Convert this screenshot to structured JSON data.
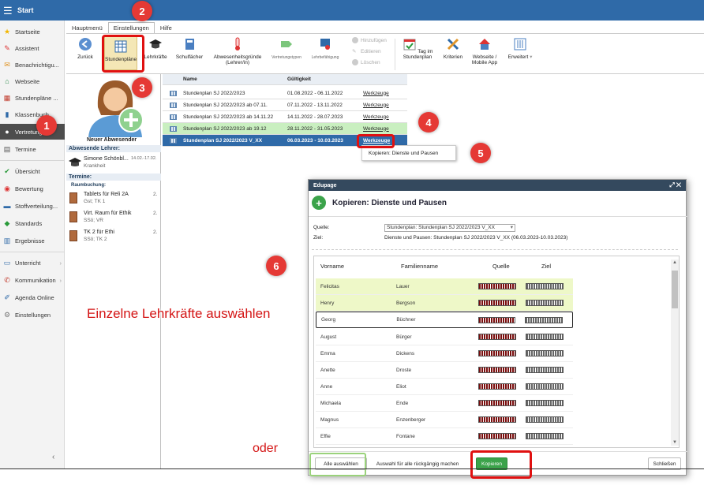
{
  "topbar": {
    "title": "Start"
  },
  "sidebar": {
    "items": [
      {
        "label": "Startseite",
        "icon": "star-icon"
      },
      {
        "label": "Assistent",
        "icon": "wand-icon"
      },
      {
        "label": "Benachrichtigu...",
        "icon": "envelope-icon"
      },
      {
        "label": "Webseite",
        "icon": "home-icon"
      },
      {
        "label": "Stundenpläne ...",
        "icon": "calendar-icon"
      },
      {
        "label": "Klassenbuch",
        "icon": "book-icon"
      },
      {
        "label": "Vertretung",
        "icon": "user-icon"
      },
      {
        "label": "Termine",
        "icon": "calendar-grid-icon"
      },
      {
        "label": "Übersicht",
        "icon": "check-circle-icon"
      },
      {
        "label": "Bewertung",
        "icon": "gauge-icon"
      },
      {
        "label": "Stoffverteilung...",
        "icon": "list-icon"
      },
      {
        "label": "Standards",
        "icon": "shield-icon"
      },
      {
        "label": "Ergebnisse",
        "icon": "chart-icon"
      },
      {
        "label": "Unterricht",
        "icon": "board-icon"
      },
      {
        "label": "Kommunikation",
        "icon": "chat-icon"
      },
      {
        "label": "Agenda Online",
        "icon": "pen-icon"
      },
      {
        "label": "Einstellungen",
        "icon": "gear-icon"
      }
    ]
  },
  "tabs": [
    "Hauptmenü",
    "Einstellungen",
    "Hilfe"
  ],
  "ribbon": {
    "zurueck": "Zurück",
    "stundenplaene": "Stundenpläne",
    "lehrkraefte": "Lehrkräfte",
    "schulfaecher": "Schulfächer",
    "abwesenheitsgruende": "Abwesenheitsgründe (Lehrer/in)",
    "vertretungstypen": "Vertretungstypen",
    "lehrbefaehigung": "Lehrbefähigung",
    "hinzufuegen": "Hinzufügen",
    "editieren": "Editieren",
    "loeschen": "Löschen",
    "tag_im_stundenplan": "Tag im Stundenplan",
    "kriterien": "Kriterien",
    "webseite_app": "Webseite / Mobile App",
    "erweitert": "Erweitert"
  },
  "leftpanel": {
    "neuer_abwesender": "Neuer Abwesender",
    "abwesende_header": "Abwesende Lehrer:",
    "teacher_name": "Simone Schönbl...",
    "teacher_date": "14.02.-17.02.",
    "teacher_reason": "Krankheit",
    "termine_header": "Termine:",
    "raumbuchung": "Raumbuchung:",
    "bookings": [
      {
        "title": "Tablets für Reli 2A",
        "sub": "Gst; TK 1",
        "num": "2."
      },
      {
        "title": "Virt. Raum für Ethik",
        "sub": "SSö; VR",
        "num": "2."
      },
      {
        "title": "TK 2 für Ethi",
        "sub": "SSö; TK 2",
        "num": "2."
      }
    ]
  },
  "table": {
    "headers": {
      "name": "Name",
      "gueltigkeit": "Gültigkeit"
    },
    "rows": [
      {
        "name": "Stundenplan SJ 2022/2023",
        "range": "01.08.2022 - 06.11.2022",
        "tool": "Werkzeuge"
      },
      {
        "name": "Stundenplan SJ 2022/2023 ab 07.11.",
        "range": "07.11.2022 - 13.11.2022",
        "tool": "Werkzeuge"
      },
      {
        "name": "Stundenplan SJ 2022/2023 ab 14.11.22",
        "range": "14.11.2022 - 28.07.2023",
        "tool": "Werkzeuge"
      },
      {
        "name": "Stundenplan SJ 2022/2023 ab 19.12",
        "range": "28.11.2022 - 31.05.2023",
        "tool": "Werkzeuge"
      },
      {
        "name": "Stundenplan SJ 2022/2023 V_XX",
        "range": "06.03.2023 - 10.03.2023",
        "tool": "Werkzeuge"
      }
    ],
    "context_menu": "Kopieren: Dienste und Pausen"
  },
  "dialog": {
    "window_title": "Edupage",
    "heading": "Kopieren: Dienste und Pausen",
    "quelle_label": "Quelle:",
    "quelle_value": "Stundenplan: Stundenplan SJ 2022/2023 V_XX",
    "ziel_label": "Ziel:",
    "ziel_value": "Dienste und Pausen: Stundenplan SJ 2022/2023 V_XX (06.03.2023-10.03.2023)",
    "columns": {
      "vorname": "Vorname",
      "familienname": "Familienname",
      "quelle": "Quelle",
      "ziel": "Ziel"
    },
    "rows": [
      {
        "vorname": "Felicitas",
        "familienname": "Lauer",
        "highlight": true
      },
      {
        "vorname": "Henry",
        "familienname": "Bergson",
        "highlight": true
      },
      {
        "vorname": "Georg",
        "familienname": "Büchner",
        "highlight": false
      },
      {
        "vorname": "August",
        "familienname": "Bürger",
        "highlight": false
      },
      {
        "vorname": "Emma",
        "familienname": "Dickens",
        "highlight": false
      },
      {
        "vorname": "Anette",
        "familienname": "Droste",
        "highlight": false
      },
      {
        "vorname": "Anne",
        "familienname": "Eliot",
        "highlight": false
      },
      {
        "vorname": "Michaela",
        "familienname": "Ende",
        "highlight": false
      },
      {
        "vorname": "Magnus",
        "familienname": "Enzenberger",
        "highlight": false
      },
      {
        "vorname": "Effie",
        "familienname": "Fontane",
        "highlight": false
      }
    ],
    "btn_alle": "Alle auswählen",
    "btn_undo": "Auswahl für alle rückgängig machen",
    "btn_kopieren": "Kopieren",
    "btn_schliessen": "Schließen"
  },
  "annotations": {
    "badges": [
      "1",
      "2",
      "3",
      "4",
      "5",
      "6"
    ],
    "einzelne": "Einzelne Lehrkräfte auswählen",
    "oder": "oder"
  },
  "colors": {
    "brand": "#2f6aa8",
    "highlight_red": "#e01010",
    "accent_green": "#3ba34a"
  }
}
